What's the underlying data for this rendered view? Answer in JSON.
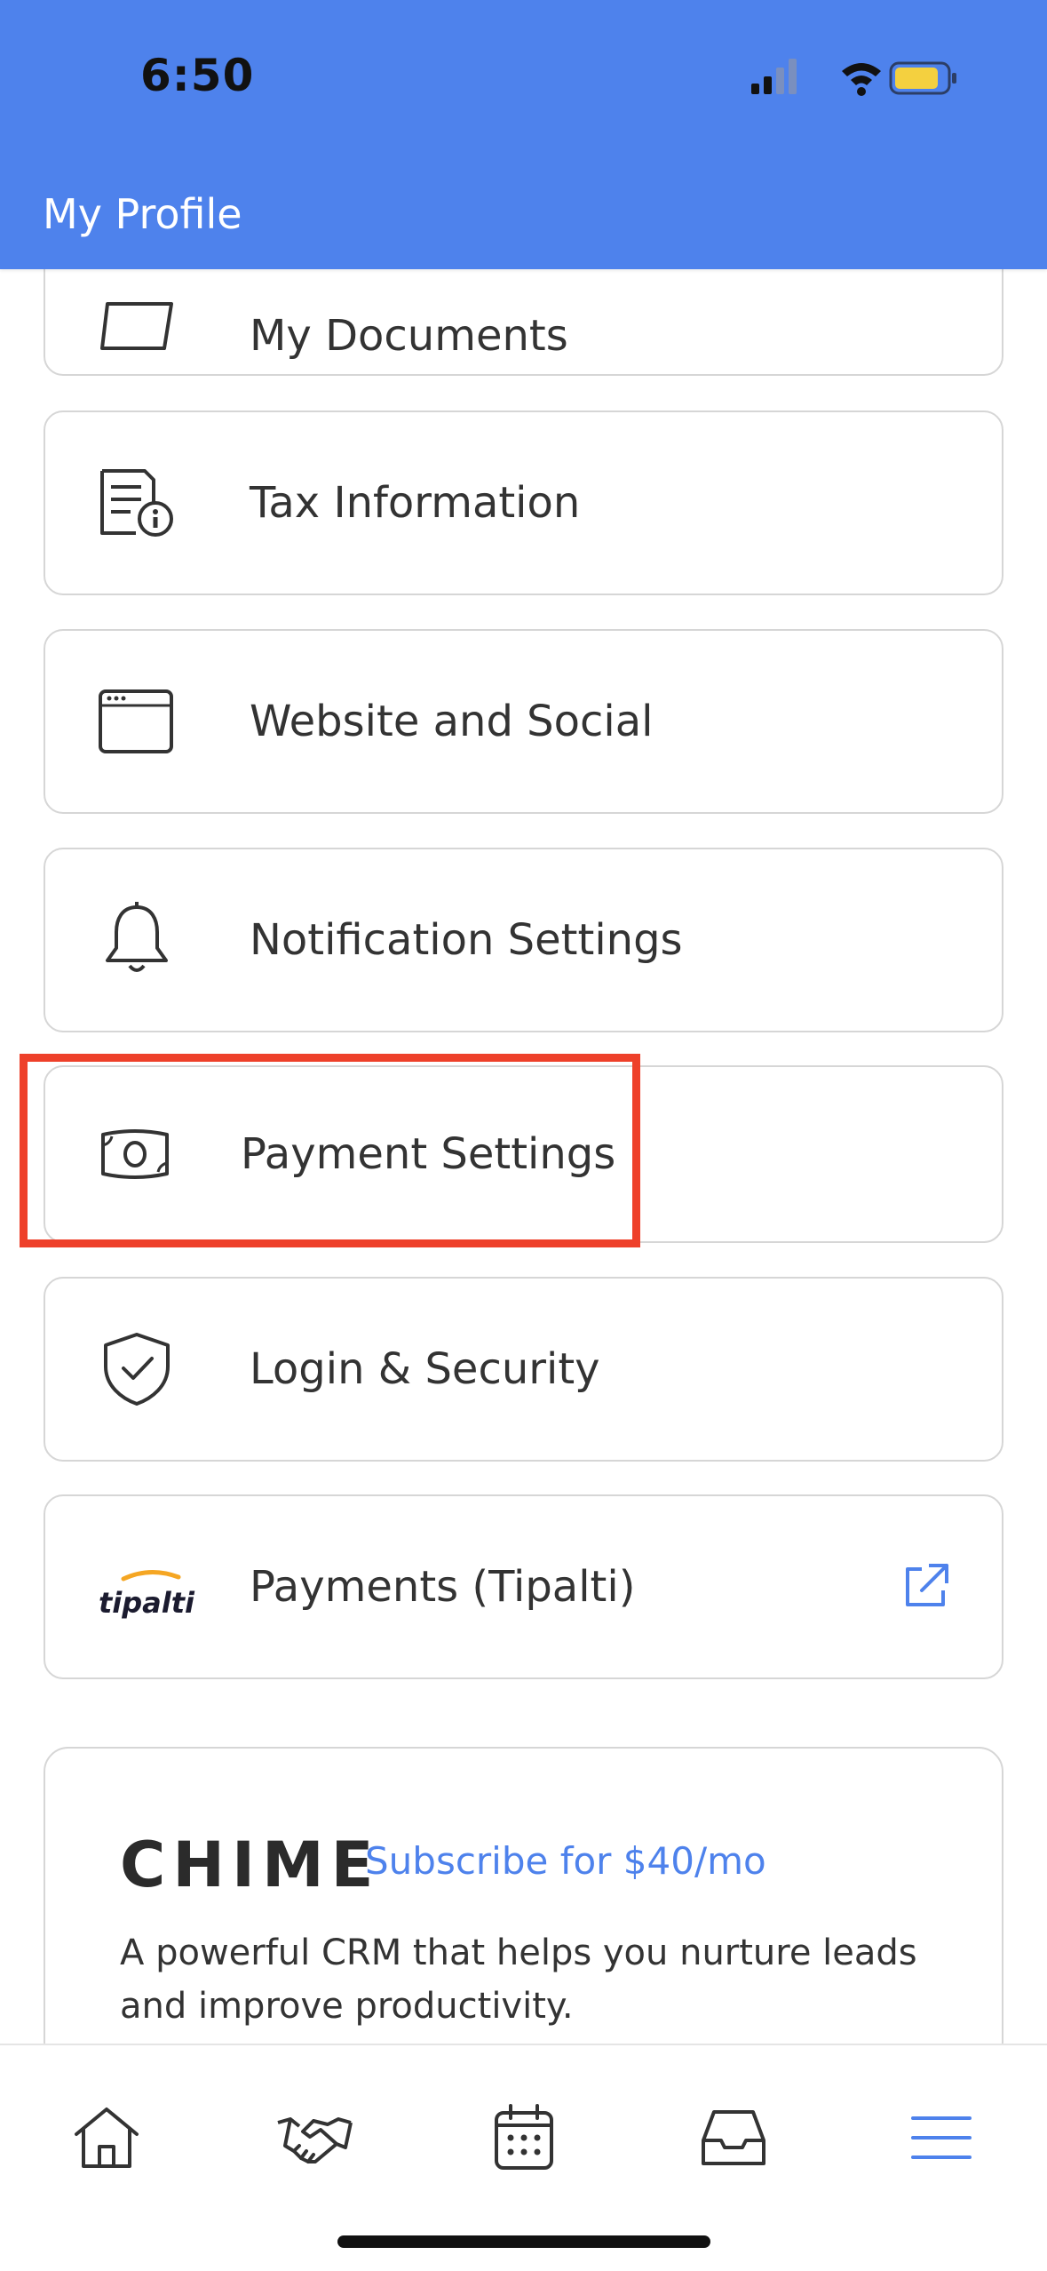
{
  "status_bar": {
    "time": "6:50"
  },
  "header": {
    "title": "My Profile"
  },
  "menu": {
    "items": [
      {
        "label": "My Documents",
        "icon": "folder-icon"
      },
      {
        "label": "Tax Information",
        "icon": "document-info-icon"
      },
      {
        "label": "Website and Social",
        "icon": "browser-window-icon"
      },
      {
        "label": "Notification Settings",
        "icon": "bell-icon"
      },
      {
        "label": "Payment Settings",
        "icon": "banknote-icon"
      },
      {
        "label": "Login & Security",
        "icon": "shield-check-icon"
      },
      {
        "label": "Payments (Tipalti)",
        "icon": "tipalti-logo",
        "logo_text": "tipalti"
      }
    ]
  },
  "promo": {
    "brand": "CHIME",
    "link": "Subscribe for $40/mo",
    "description": "A powerful CRM that helps you nurture leads and improve productivity."
  },
  "tabbar": {
    "tabs": [
      {
        "name": "home",
        "icon": "home-icon"
      },
      {
        "name": "deals",
        "icon": "handshake-icon"
      },
      {
        "name": "calendar",
        "icon": "calendar-icon"
      },
      {
        "name": "inbox",
        "icon": "inbox-tray-icon"
      },
      {
        "name": "menu",
        "icon": "hamburger-menu-icon",
        "active": true
      }
    ]
  },
  "colors": {
    "header": "#4E82EC",
    "accent": "#4E82EC",
    "highlight": "#EE402A",
    "border": "#D6D6D6",
    "battery": "#F4D03F"
  }
}
